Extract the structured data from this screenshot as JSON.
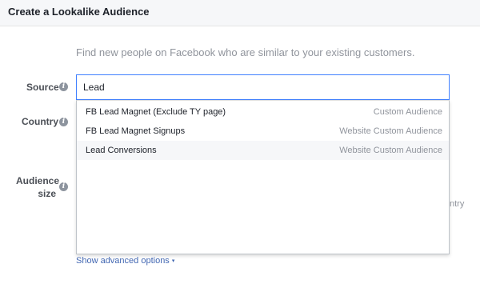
{
  "dialog": {
    "title": "Create a Lookalike Audience",
    "intro": "Find new people on Facebook who are similar to your existing customers."
  },
  "form": {
    "source_label": "Source",
    "source_value": "Lead",
    "country_label": "Country",
    "audience_size_label_line1": "Audience",
    "audience_size_label_line2": "size",
    "info_icon_glyph": "i"
  },
  "dropdown": {
    "options": [
      {
        "name": "FB Lead Magnet (Exclude TY page)",
        "type": "Custom Audience"
      },
      {
        "name": "FB Lead Magnet Signups",
        "type": "Website Custom Audience"
      },
      {
        "name": "Lead Conversions",
        "type": "Website Custom Audience"
      }
    ]
  },
  "background": {
    "partial_text": "ntry"
  },
  "advanced": {
    "label": "Show advanced options",
    "caret": "▾"
  },
  "colors": {
    "accent": "#4267b2",
    "focus_border": "#4080ff",
    "muted_text": "#90949c"
  }
}
